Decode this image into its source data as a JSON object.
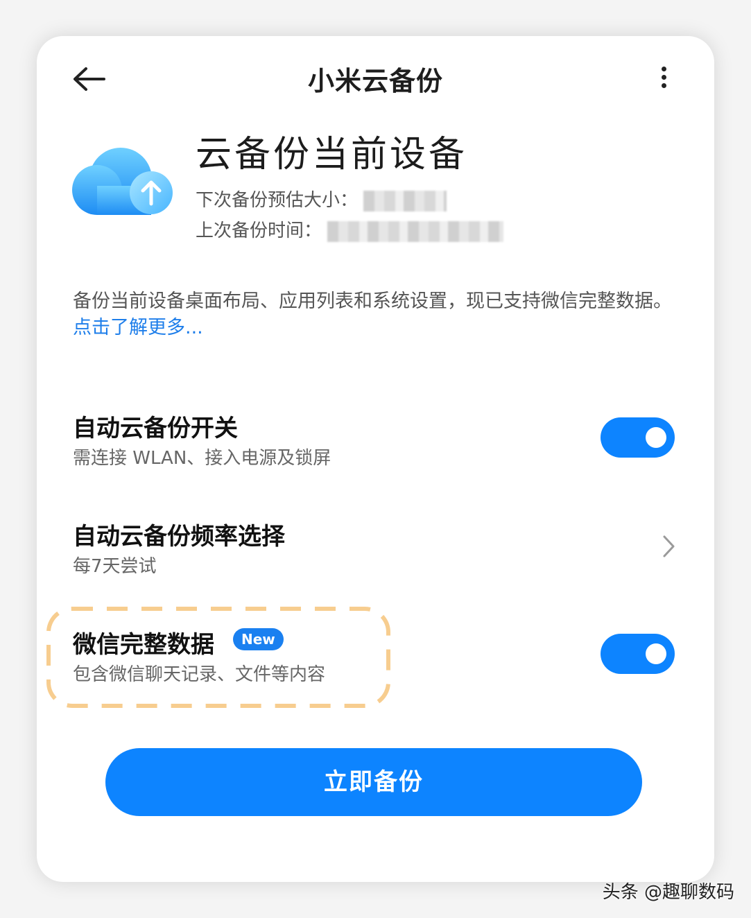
{
  "header": {
    "back_icon": "arrow-left-icon",
    "title": "小米云备份",
    "more_icon": "more-vertical-icon"
  },
  "hero": {
    "icon": "cloud-upload-icon",
    "title": "云备份当前设备",
    "next_size_label": "下次备份预估大小：",
    "last_time_label": "上次备份时间："
  },
  "description": {
    "text": "备份当前设备桌面布局、应用列表和系统设置，现已支持微信完整数据。",
    "link": "点击了解更多..."
  },
  "settings": {
    "auto_backup": {
      "title": "自动云备份开关",
      "subtitle": "需连接 WLAN、接入电源及锁屏",
      "enabled": true
    },
    "frequency": {
      "title": "自动云备份频率选择",
      "subtitle": "每7天尝试",
      "icon": "chevron-right-icon"
    },
    "wechat": {
      "title": "微信完整数据",
      "badge": "New",
      "subtitle": "包含微信聊天记录、文件等内容",
      "enabled": true
    }
  },
  "backup_button": {
    "label": "立即备份"
  },
  "watermark": "头条 @趣聊数码",
  "colors": {
    "accent": "#0d84ff",
    "link": "#1e7eea",
    "highlight_border": "#f7cd8f"
  }
}
